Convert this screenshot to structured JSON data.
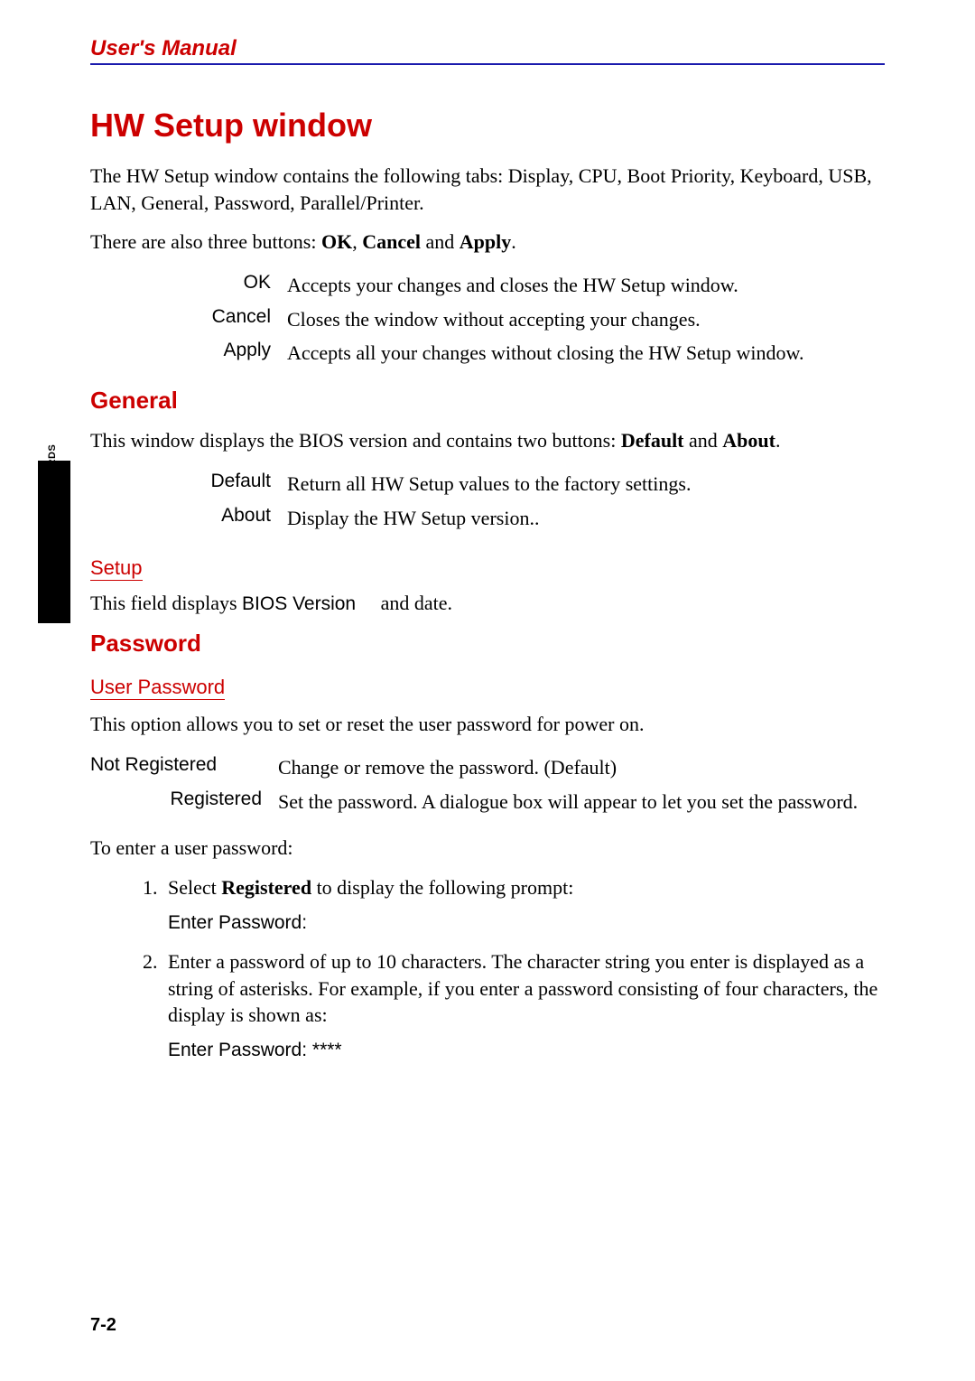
{
  "header": "User's Manual",
  "title": "HW Setup window",
  "intro_p1": "The HW Setup window contains the following tabs: Display,  CPU, Boot Priority, Keyboard, USB, LAN, General, Password, Parallel/Printer.",
  "intro_p2_pre": "There are also three buttons: ",
  "intro_p2_b1": "OK",
  "intro_p2_sep1": ", ",
  "intro_p2_b2": "Cancel",
  "intro_p2_sep2": " and ",
  "intro_p2_b3": "Apply",
  "intro_p2_post": ".",
  "buttons": [
    {
      "term": "OK",
      "desc": "Accepts your changes and closes the HW Setup window."
    },
    {
      "term": "Cancel",
      "desc": "Closes the window without accepting your changes."
    },
    {
      "term": "Apply",
      "desc": "Accepts all your changes without closing the HW Setup window."
    }
  ],
  "general_heading": "General",
  "general_p_pre": "This window displays the BIOS version and contains two buttons: ",
  "general_b1": "Default",
  "general_sep": " and ",
  "general_b2": "About",
  "general_post": ".",
  "general_buttons": [
    {
      "term": "Default",
      "desc": "Return all HW Setup values to the factory settings."
    },
    {
      "term": "About",
      "desc": "Display the HW Setup version.."
    }
  ],
  "setup_heading": "Setup",
  "setup_line_pre": "This field displays ",
  "setup_line_bios": "BIOS Version",
  "setup_line_post": " and date.",
  "password_heading": "Password",
  "user_pw_heading": "User Password",
  "user_pw_intro": "This option allows you to set or reset the user password for power on.",
  "pw_options": [
    {
      "term": "Not Registered",
      "desc": "Change or remove the password. (Default)"
    },
    {
      "term": "Registered",
      "desc": "Set the password. A dialogue box will appear to let you set the password."
    }
  ],
  "to_enter": "To enter a user password:",
  "step1_pre": "Select ",
  "step1_bold": "Registered",
  "step1_post": " to display the following prompt:",
  "step1_prompt": "Enter Password:",
  "step2": "Enter a password of up to 10 characters. The character string you enter is displayed as a string of asterisks. For example, if you enter a password consisting of four characters, the display is shown as:",
  "step2_prompt": "Enter Password: ****",
  "side_tab": "HW Setup and Passwords",
  "page_number": "7-2"
}
